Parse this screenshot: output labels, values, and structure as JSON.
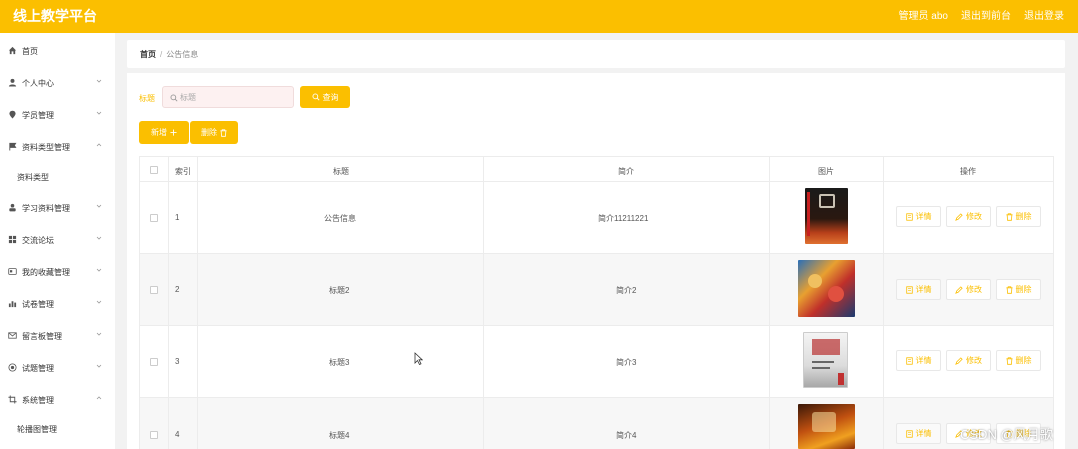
{
  "header": {
    "title": "线上教学平台",
    "admin_label": "管理员 abo",
    "front_link": "退出到前台",
    "logout_link": "退出登录"
  },
  "sidebar": {
    "items": [
      {
        "label": "首页",
        "icon": "home-icon",
        "expandable": false
      },
      {
        "label": "个人中心",
        "icon": "user-icon",
        "expandable": true
      },
      {
        "label": "学员管理",
        "icon": "location-icon",
        "expandable": true
      },
      {
        "label": "资料类型管理",
        "icon": "flag-icon",
        "expandable": true,
        "expanded": true,
        "children": [
          "资料类型"
        ]
      },
      {
        "label": "学习资料管理",
        "icon": "person-icon",
        "expandable": true
      },
      {
        "label": "交流论坛",
        "icon": "grid-icon",
        "expandable": true
      },
      {
        "label": "我的收藏管理",
        "icon": "card-icon",
        "expandable": true
      },
      {
        "label": "试卷管理",
        "icon": "chart-icon",
        "expandable": true
      },
      {
        "label": "留言板管理",
        "icon": "mail-icon",
        "expandable": true
      },
      {
        "label": "试题管理",
        "icon": "circle-icon",
        "expandable": true
      },
      {
        "label": "系统管理",
        "icon": "crop-icon",
        "expandable": true,
        "expanded": true,
        "children": [
          "轮播图管理"
        ]
      }
    ]
  },
  "breadcrumb": {
    "home": "首页",
    "current": "公告信息"
  },
  "search": {
    "label": "标题",
    "placeholder": "标题",
    "button": "查询"
  },
  "actions": {
    "add": "新增",
    "delete": "删除"
  },
  "table": {
    "headers": [
      "索引",
      "标题",
      "简介",
      "图片",
      "操作"
    ],
    "row_buttons": {
      "detail": "详情",
      "edit": "修改",
      "delete": "删除"
    },
    "rows": [
      {
        "index": "1",
        "title": "公告信息",
        "intro": "简介11211221",
        "image": "book-cover-dark"
      },
      {
        "index": "2",
        "title": "标题2",
        "intro": "简介2",
        "image": "anime-poster"
      },
      {
        "index": "3",
        "title": "标题3",
        "intro": "简介3",
        "image": "book-cover-light"
      },
      {
        "index": "4",
        "title": "标题4",
        "intro": "简介4",
        "image": "fire-poster"
      }
    ]
  },
  "watermark": "CSDN @风月歌",
  "colors": {
    "accent": "#fbbf00",
    "header_bg": "#fbbf00",
    "page_bg": "#f2f2f2"
  }
}
